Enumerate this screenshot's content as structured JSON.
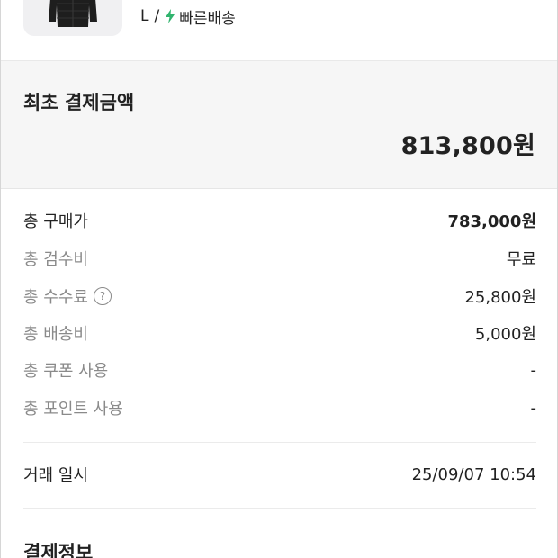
{
  "product": {
    "size": "L",
    "separator": "/",
    "shipping_icon": "lightning-bolt-icon",
    "shipping_label": "빠른배송",
    "shipping_icon_color": "#31b46e"
  },
  "initial_payment": {
    "label": "최초 결제금액",
    "amount": "813,800원"
  },
  "breakdown": [
    {
      "label": "총 구매가",
      "value": "783,000원"
    },
    {
      "label": "총 검수비",
      "value": "무료"
    },
    {
      "label": "총 수수료",
      "value": "25,800원",
      "help_icon": "question-circle-icon",
      "help_glyph": "?"
    },
    {
      "label": "총 배송비",
      "value": "5,000원"
    },
    {
      "label": "총 쿠폰 사용",
      "value": "-"
    },
    {
      "label": "총 포인트 사용",
      "value": "-"
    }
  ],
  "trade": {
    "label": "거래 일시",
    "value": "25/09/07 10:54"
  },
  "payment_info": {
    "title": "결제정보"
  },
  "colors": {
    "background_section": "#f6f6f6",
    "muted_text": "#8a8a8a",
    "primary_text": "#222222"
  }
}
